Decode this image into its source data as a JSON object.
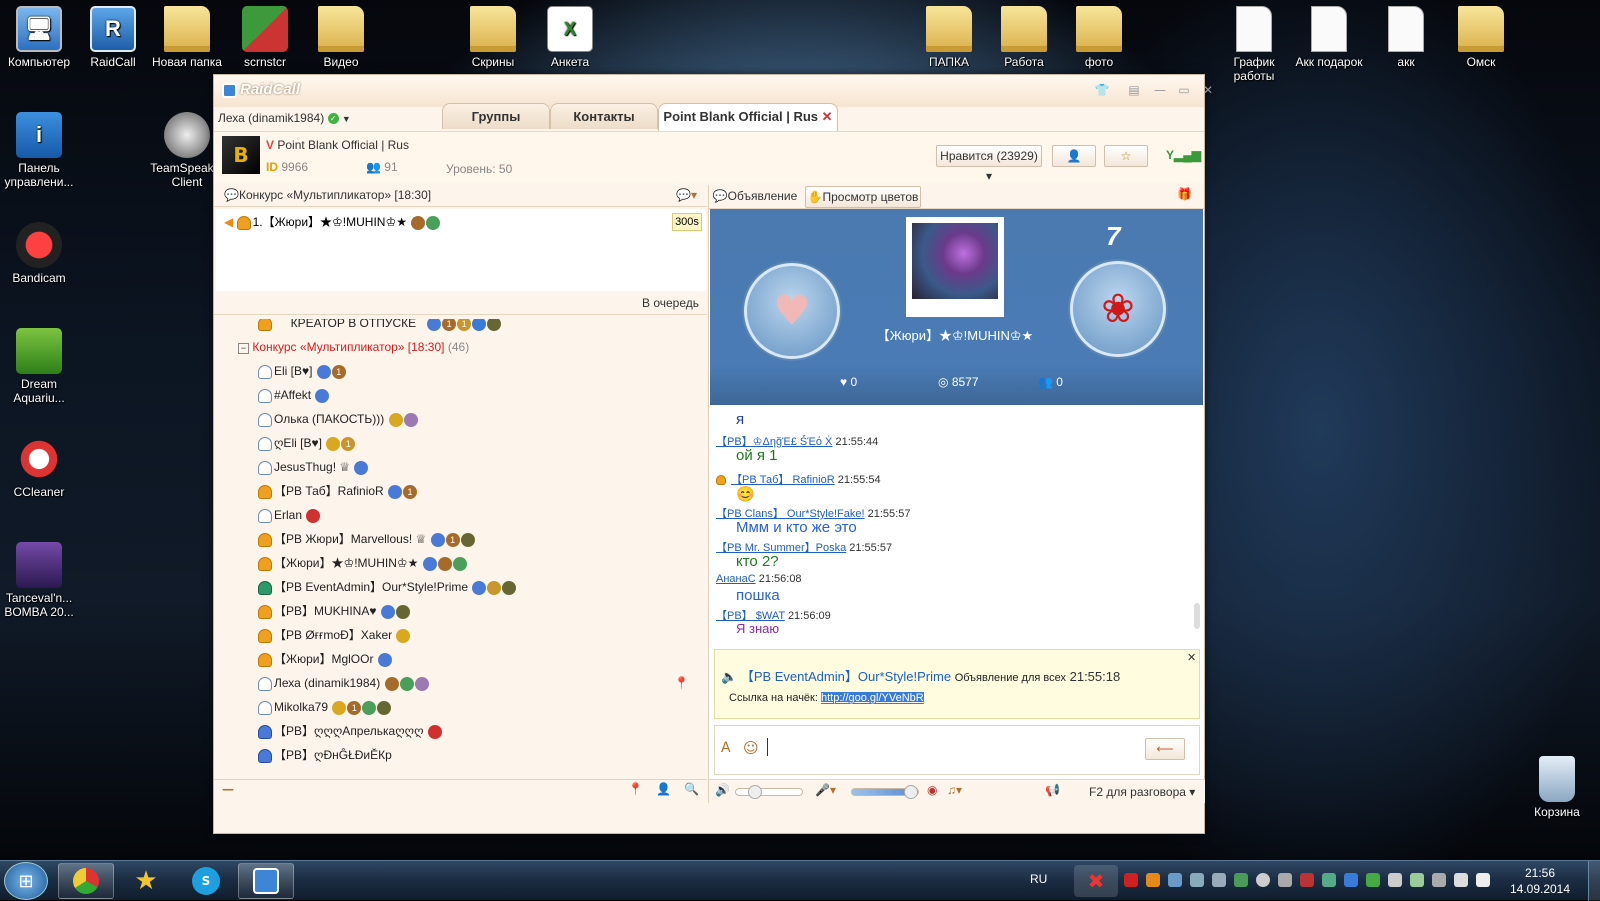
{
  "desktop": {
    "icons": [
      {
        "label": "Компьютер",
        "icon": "computer-icon",
        "glyph": "🖥"
      },
      {
        "label": "RaidCall",
        "icon": "raidcall-icon",
        "glyph": "R"
      },
      {
        "label": "Новая папка",
        "icon": "folder-icon",
        "glyph": ""
      },
      {
        "label": "scrnstcr",
        "icon": "app-icon",
        "glyph": ""
      },
      {
        "label": "Видео",
        "icon": "folder-icon",
        "glyph": ""
      },
      {
        "label": "Скрины",
        "icon": "folder-icon",
        "glyph": ""
      },
      {
        "label": "Анкета",
        "icon": "excel-doc-icon",
        "glyph": "X"
      },
      {
        "label": "ПАПКА",
        "icon": "folder-icon",
        "glyph": ""
      },
      {
        "label": "Работа",
        "icon": "folder-icon",
        "glyph": ""
      },
      {
        "label": "фото",
        "icon": "folder-icon",
        "glyph": ""
      },
      {
        "label": "График работы",
        "icon": "document-icon",
        "glyph": ""
      },
      {
        "label": "Акк подарок",
        "icon": "document-icon",
        "glyph": ""
      },
      {
        "label": "акк",
        "icon": "document-icon",
        "glyph": ""
      },
      {
        "label": "Омск",
        "icon": "folder-icon",
        "glyph": ""
      },
      {
        "label": "Панель управлени...",
        "icon": "control-panel-icon",
        "glyph": "i"
      },
      {
        "label": "TeamSpeak 3 Client",
        "icon": "teamspeak-icon",
        "glyph": ""
      },
      {
        "label": "Bandicam",
        "icon": "bandicam-icon",
        "glyph": ""
      },
      {
        "label": "Dream Aquariu...",
        "icon": "dream-aquarium-icon",
        "glyph": ""
      },
      {
        "label": "CCleaner",
        "icon": "ccleaner-icon",
        "glyph": ""
      },
      {
        "label": "Tanceval'n... BOMBA 20...",
        "icon": "video-icon",
        "glyph": ""
      },
      {
        "label": "Корзина",
        "icon": "recycle-bin-icon",
        "glyph": ""
      }
    ]
  },
  "app": {
    "logo": "RaidCall",
    "user": "Леха (dinamik1984)",
    "tabs": [
      "Группы",
      "Контакты",
      "Point Blank Official | Rus"
    ],
    "group": {
      "name": "Point Blank Official | Rus",
      "id_label": "ID",
      "id": "9966",
      "members": "91",
      "level": "Уровень: 50",
      "like": "Нравится (23929)"
    },
    "left": {
      "contest": "Конкурс «Мультипликатор» [18:30]",
      "queue_item": "1.【Жюри】★♔!MUHIN♔★",
      "timer": "300s",
      "queue_btn": "В очередь",
      "tree_creator": "КРЕАТОР В ОТПУСКЕ",
      "tree_channel": "Конкурс «Мультипликатор» [18:30]",
      "tree_channel_count": "(46)",
      "users": [
        "Eli [B♥]",
        "#Affekt",
        "Олька (ПАКОСТЬ)))",
        "ღEli [B♥]",
        "JesusThug! ♕",
        "【PB Таб】RafinioR",
        "Erlan",
        "【PB Жюри】Marvellous! ♕",
        "【Жюри】★♔!MUHIN♔★",
        "【PB EventAdmin】Our*Style!Prime",
        "【PB】MUKHINA♥",
        "【PB ØғғmoÐ】Xaker",
        "【Жюри】MglOOr",
        "Леха (dinamik1984)",
        "Mikolka79",
        "【PB】ღღღАпрелькаღღღ",
        "【PB】ღĐнĜŁĐиĚКр"
      ]
    },
    "right": {
      "announce_btn": "Объявление",
      "flowers_btn": "Просмотр цветов",
      "performer": "【Жюри】★♔!MUHIN♔★",
      "flowers_count": "7",
      "stat_hearts": "0",
      "stat_score": "8577",
      "stat_fans": "0",
      "chat": [
        {
          "text": "я",
          "color": "#2040b0"
        },
        {
          "meta": "【PB】♔ΔηğΈ£ ṤΈό Ẋ",
          "time": "21:55:44",
          "text": "ой я 1",
          "color": "#1f7a1f"
        },
        {
          "meta": "【PB Таб】 RafinioR",
          "time": "21:55:54",
          "text": "😊",
          "color": "#333"
        },
        {
          "meta": "【PB Clans】 Our*Style!Fake!",
          "time": "21:55:57",
          "text": "Ммм и кто же это",
          "color": "#2a62d8"
        },
        {
          "meta": "【PB Mr. Summer】Poska",
          "time": "21:55:57",
          "text": "кто 2?",
          "color": "#1f7a1f"
        },
        {
          "meta": "АнанаС",
          "time": "21:56:08",
          "text": "пошка",
          "color": "#2a62d8"
        },
        {
          "meta": "【PB】 $WAT",
          "time": "21:56:09",
          "text": "Я знаю",
          "color": "#8a2ab0"
        }
      ],
      "notice": {
        "sender": "【PB EventAdmin】Our*Style!Prime",
        "label": "Объявление для всех",
        "time": "21:55:18",
        "body": "Ссылка на начёк:",
        "link": "http://goo.gl/YVeNbR"
      },
      "talk_mode": "F2 для разговора"
    }
  },
  "taskbar": {
    "lang": "RU",
    "time": "21:56",
    "date": "14.09.2014"
  },
  "colors": {
    "accent": "#4a7bb5",
    "window_bg": "#fdf5ec",
    "contest_red": "#d02020"
  }
}
